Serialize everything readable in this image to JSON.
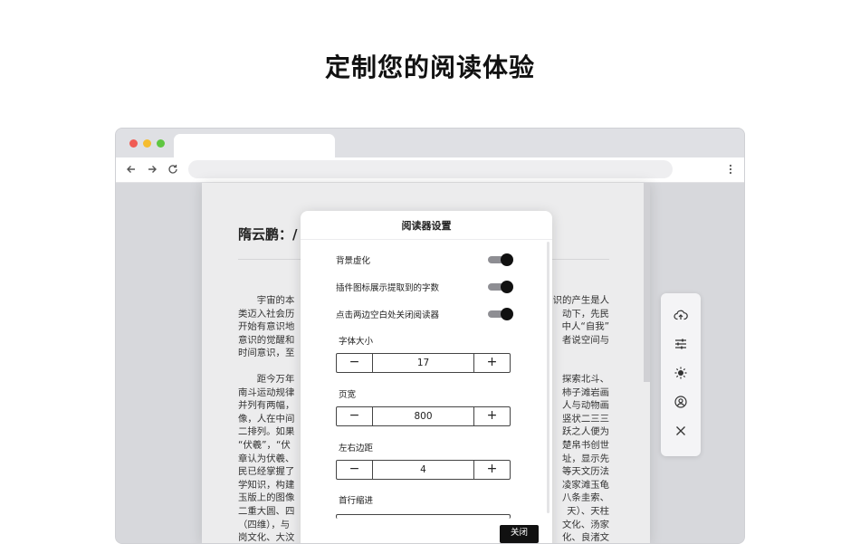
{
  "headline": "定制您的阅读体验",
  "browser": {
    "nav": {
      "back_icon": "arrow-left",
      "forward_icon": "arrow-right",
      "reload_icon": "reload",
      "menu_icon": "more-vertical"
    }
  },
  "article": {
    "title": "隋云鹏：/",
    "paragraphs": [
      {
        "lines": [
          {
            "l": "　　宇宙的本",
            "r": "识的产生是人"
          },
          {
            "l": "类迈入社会历",
            "r": "动下，先民"
          },
          {
            "l": "开始有意识地",
            "r": "中人“自我”"
          },
          {
            "l": "意识的觉醒和",
            "r": "者说空间与"
          },
          {
            "l": "时间意识，至",
            "r": ""
          }
        ]
      },
      {
        "lines": [
          {
            "l": "　　距今万年",
            "r": "探索北斗、"
          },
          {
            "l": "南斗运动规律",
            "r": "柿子滩岩画"
          },
          {
            "l": "并列有两幅，",
            "r": "人与动物画"
          },
          {
            "l": "像，人在中间",
            "r": "竖状二三三"
          },
          {
            "l": "二排列。如果",
            "r": "跃之人便为"
          },
          {
            "l": "“伏羲”，“伏",
            "r": "楚帛书创世"
          },
          {
            "l": "章认为伏羲、",
            "r": "址，显示先"
          },
          {
            "l": "民已经掌握了",
            "r": "等天文历法"
          },
          {
            "l": "学知识，构建",
            "r": "凌家滩玉龟"
          },
          {
            "l": "玉版上的图像",
            "r": "八条圭索、"
          },
          {
            "l": "二重大圆、四",
            "r": "天）、天柱"
          },
          {
            "l": "（四维），与",
            "r": "文化、汤家"
          },
          {
            "l": "岗文化、大汶",
            "r": "化、良渚文"
          }
        ]
      }
    ]
  },
  "side_panel": {
    "icons": [
      "cloud-upload-icon",
      "sliders-icon",
      "sun-icon",
      "user-circle-icon",
      "close-icon"
    ]
  },
  "settings": {
    "title": "阅读器设置",
    "toggles": [
      {
        "label": "背景虚化",
        "on": true
      },
      {
        "label": "插件图标展示提取到的字数",
        "on": true
      },
      {
        "label": "点击两边空白处关闭阅读器",
        "on": true
      }
    ],
    "font_size": {
      "label": "字体大小",
      "value": "17",
      "minus": "−",
      "plus": "+"
    },
    "page_width": {
      "label": "页宽",
      "value": "800",
      "minus": "−",
      "plus": "+"
    },
    "margin": {
      "label": "左右边距",
      "value": "4",
      "minus": "−",
      "plus": "+"
    },
    "indent": {
      "label": "首行缩进"
    },
    "close_label": "关闭"
  }
}
